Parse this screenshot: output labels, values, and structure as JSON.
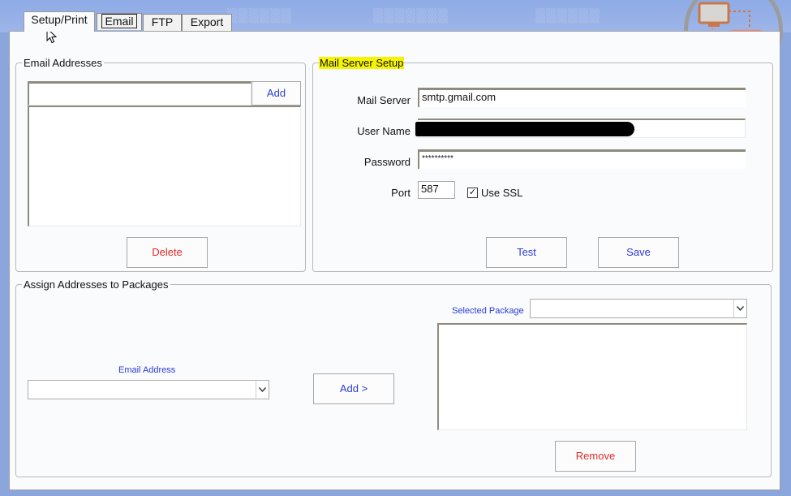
{
  "tabs": [
    {
      "label": "Setup/Print"
    },
    {
      "label": "Email"
    },
    {
      "label": "FTP"
    },
    {
      "label": "Export"
    }
  ],
  "email_addresses": {
    "legend": "Email Addresses",
    "input_value": "",
    "add_label": "Add",
    "delete_label": "Delete"
  },
  "mail_server": {
    "legend": "Mail Server Setup",
    "mail_server_label": "Mail Server",
    "mail_server_value": "smtp.gmail.com",
    "user_name_label": "User Name",
    "password_label": "Password",
    "password_value": "**********",
    "port_label": "Port",
    "port_value": "587",
    "ssl_label": "Use SSL",
    "ssl_checked": true,
    "test_label": "Test",
    "save_label": "Save"
  },
  "assign": {
    "legend": "Assign Addresses to Packages",
    "email_address_label": "Email Address",
    "email_address_value": "",
    "add_label": "Add  >",
    "selected_package_label": "Selected Package",
    "selected_package_value": "",
    "remove_label": "Remove"
  },
  "colors": {
    "accent_blue": "#2b3bd6",
    "danger_red": "#e12a2a",
    "highlight_yellow": "#f6f400",
    "background_blue": "#8aa6dd"
  },
  "icons": {
    "logo": "remote-desktop-logo-icon",
    "checkbox": "checkmark-icon",
    "dropdown": "chevron-down-icon",
    "cursor": "mouse-pointer-icon"
  }
}
